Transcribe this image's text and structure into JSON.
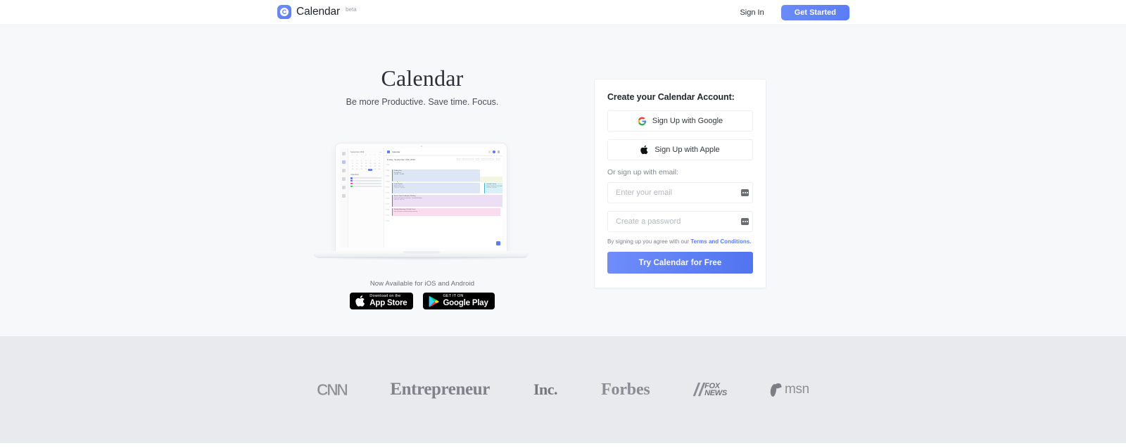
{
  "header": {
    "brand_name": "Calendar",
    "brand_badge": "beta",
    "logo_letter": "C",
    "sign_in": "Sign In",
    "get_started": "Get Started",
    "accent_color": "#5b7cf7"
  },
  "hero": {
    "title": "Calendar",
    "subtitle": "Be more Productive. Save time. Focus.",
    "stores_label": "Now Available for iOS and Android",
    "app_store": {
      "line1": "Download on the",
      "line2": "App Store"
    },
    "google_play": {
      "line1": "GET IT ON",
      "line2": "Google Play"
    }
  },
  "mockup": {
    "app_name": "Calendar",
    "sidebar_month": "September 2019",
    "month_arrows": "‹ ›",
    "date_header": "Friday, September 27th 2019",
    "toolbar": {
      "prev": "‹",
      "today": "Today",
      "next": "›",
      "view": "Day"
    },
    "calendars_label": "Calendars",
    "calendars": [
      {
        "name": "johndoe@outlook.com",
        "color": "#5b7cf7"
      },
      {
        "name": "john@gmail.com",
        "color": "#8b5bd4"
      },
      {
        "name": "meetings@calendar.com",
        "color": "#e055a8"
      },
      {
        "name": "john@calendar.com",
        "color": "#5bbf6a"
      }
    ],
    "day_labels": [
      "S",
      "M",
      "T",
      "W",
      "T",
      "F",
      "S"
    ],
    "today_day": "27",
    "hours": [
      "8 AM",
      "9 AM",
      "10 AM",
      "11 AM",
      "12 PM",
      "1 PM",
      "2 PM",
      "3 PM",
      "4 PM",
      "5 PM",
      "6 PM"
    ],
    "events": [
      {
        "title": "Coding Day",
        "meta": "No attendees",
        "time": "9:00 AM – 9:30 AM",
        "color": "#dce6f5",
        "accent": "#5b7cf7"
      },
      {
        "title": "Lunch with Cyan",
        "meta": "Attending: Joe Bryant & Tim Kerr, Cafeteria",
        "time": "",
        "color": "#f2f6e3",
        "accent": "#9fc12c"
      },
      {
        "title": "Code Review",
        "meta": "Andrew Nunez etc.",
        "time": "12:00 PM – 1:00 PM",
        "color": "#dce6f5",
        "accent": "#5b7cf7"
      },
      {
        "title": "Call with Jenny",
        "meta": "Happy Consultants and Lead Calendar Sales Co.",
        "time": "1:30 PM – 2:00 PM",
        "color": "#d9f0f7",
        "accent": "#3fb6cf"
      },
      {
        "title": "Soccer Team Fundraiser Meeting",
        "meta": "Open to all fundraiser volunteers, Greenfield Stadium",
        "time": "3:00 PM – 4:00 PM",
        "color": "#ecdef5",
        "accent": "#8b5bd4"
      },
      {
        "title": "Weekly Marketing Call with Team",
        "meta": "https://calendar.com/room/weekly-marketing",
        "time": "",
        "color": "#fadcee",
        "accent": "#e055a8"
      }
    ]
  },
  "signup": {
    "title": "Create your Calendar Account:",
    "google_button": "Sign Up with Google",
    "apple_button": "Sign Up with Apple",
    "or_label": "Or sign up with email:",
    "email_placeholder": "Enter your email",
    "email_value": "",
    "password_placeholder": "Create a password",
    "password_value": "",
    "terms_prefix": "By signing up you agree with our",
    "terms_link": "Terms and Conditions.",
    "cta": "Try Calendar for Free"
  },
  "press": {
    "cnn": "CNN",
    "entrepreneur": "Entrepreneur",
    "inc": "Inc.",
    "forbes": "Forbes",
    "fox_slash": "//",
    "fox_line1": "FOX",
    "fox_line2": "NEWS",
    "msn": "msn"
  }
}
